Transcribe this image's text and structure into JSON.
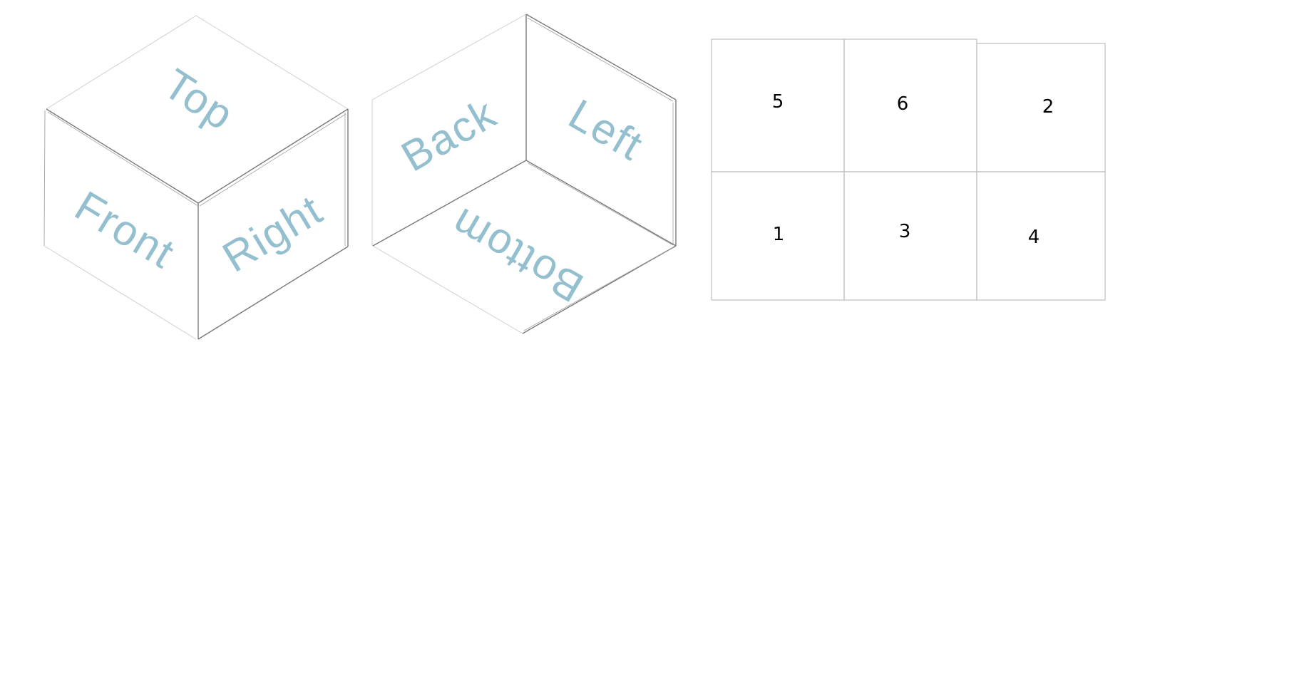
{
  "colors": {
    "label": "#93bfcf",
    "edge": "#7a7a7a",
    "grid_line": "#bdbdbd",
    "number": "#000000"
  },
  "cube_outer": {
    "top": "Top",
    "front": "Front",
    "right": "Right"
  },
  "cube_inner": {
    "back": "Back",
    "left": "Left",
    "bottom": "Bottom"
  },
  "grid": {
    "rows": [
      [
        "5",
        "6",
        "2"
      ],
      [
        "1",
        "3",
        "4"
      ]
    ]
  }
}
